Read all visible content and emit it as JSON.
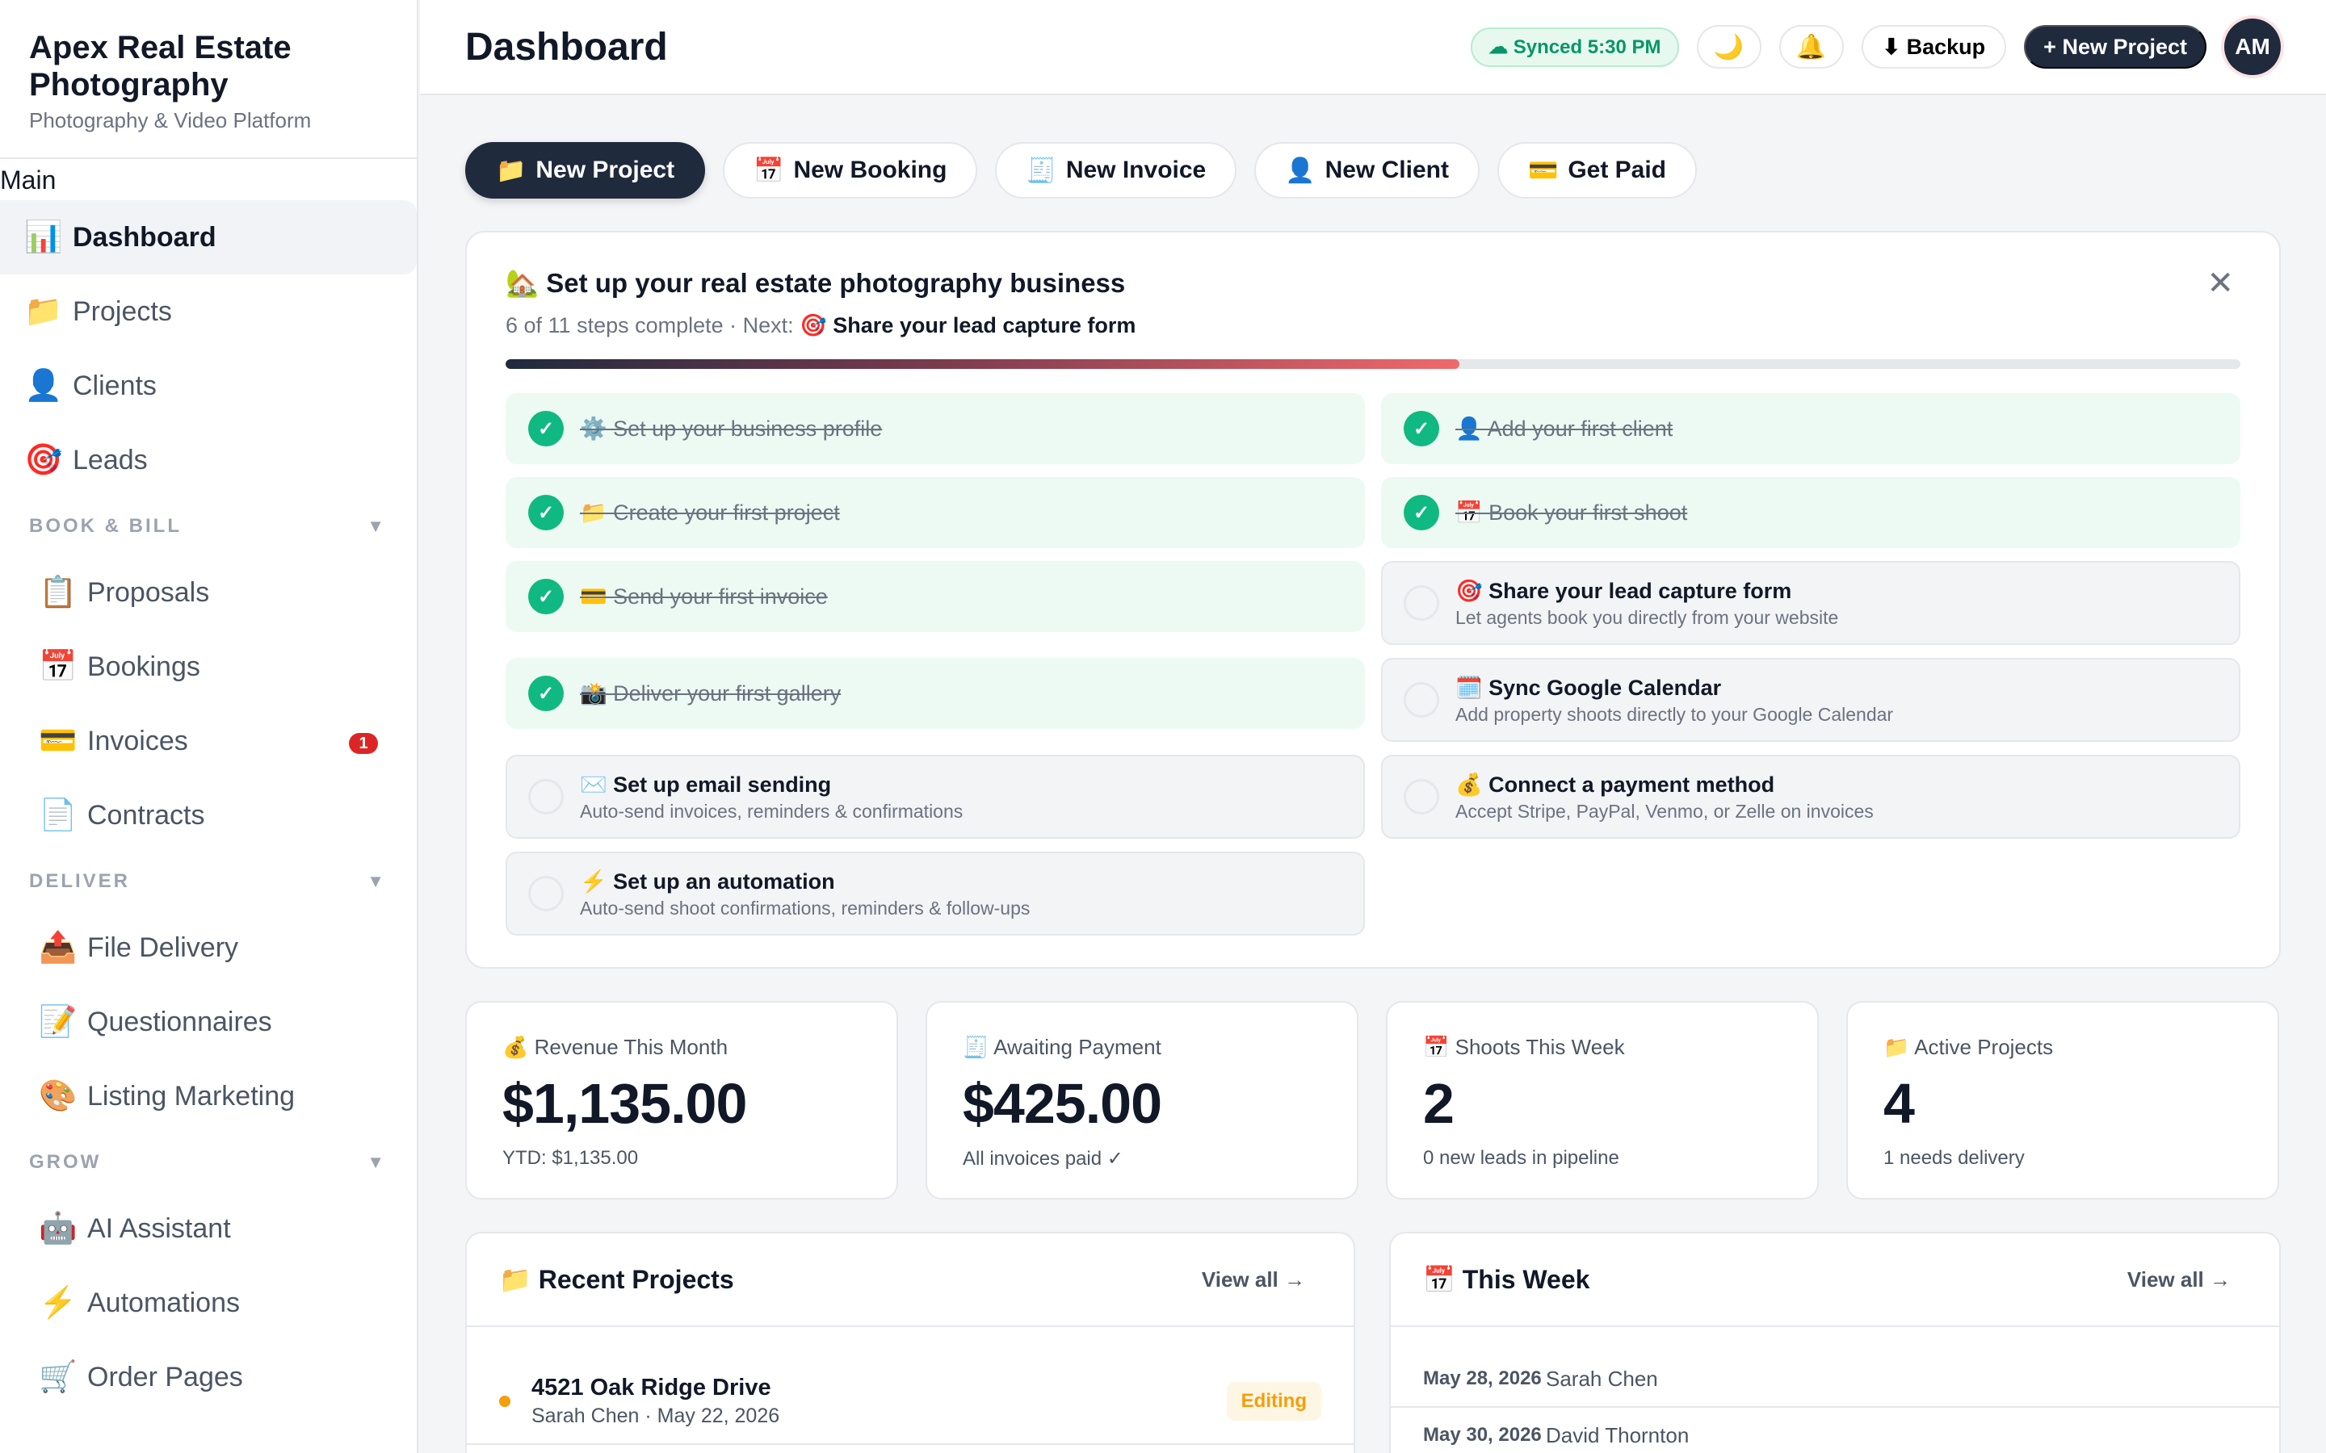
{
  "sidebar": {
    "brand_name": "Apex Real Estate Photography",
    "brand_sub": "Photography & Video Platform",
    "section_main": "Main",
    "main_items": [
      {
        "icon": "📊",
        "label": "Dashboard"
      },
      {
        "icon": "📁",
        "label": "Projects"
      },
      {
        "icon": "👤",
        "label": "Clients"
      },
      {
        "icon": "🎯",
        "label": "Leads"
      }
    ],
    "groups": [
      {
        "title": "BOOK & BILL",
        "items": [
          {
            "icon": "📋",
            "label": "Proposals"
          },
          {
            "icon": "📅",
            "label": "Bookings"
          },
          {
            "icon": "💳",
            "label": "Invoices",
            "badge": "1"
          },
          {
            "icon": "📄",
            "label": "Contracts"
          }
        ]
      },
      {
        "title": "DELIVER",
        "items": [
          {
            "icon": "📤",
            "label": "File Delivery"
          },
          {
            "icon": "📝",
            "label": "Questionnaires"
          },
          {
            "icon": "🎨",
            "label": "Listing Marketing"
          }
        ]
      },
      {
        "title": "GROW",
        "items": [
          {
            "icon": "🤖",
            "label": "AI Assistant"
          },
          {
            "icon": "⚡",
            "label": "Automations"
          },
          {
            "icon": "🛒",
            "label": "Order Pages"
          }
        ]
      }
    ]
  },
  "header": {
    "title": "Dashboard",
    "synced": "☁ Synced 5:30 PM",
    "theme_icon": "🌙",
    "bell_icon": "🔔",
    "backup": "⬇ Backup",
    "new_project": "+ New Project",
    "avatar": "AM"
  },
  "quick_actions": [
    {
      "icon": "📁",
      "label": "New Project"
    },
    {
      "icon": "📅",
      "label": "New Booking"
    },
    {
      "icon": "🧾",
      "label": "New Invoice"
    },
    {
      "icon": "👤",
      "label": "New Client"
    },
    {
      "icon": "💳",
      "label": "Get Paid"
    }
  ],
  "setup": {
    "title": "🏡 Set up your real estate photography business",
    "progress_text": "6 of 11 steps complete · Next: ",
    "next_step": "🎯 Share your lead capture form",
    "progress_fraction": 0.55,
    "close": "✕",
    "steps": [
      {
        "label": "⚙️ Set up your business profile",
        "done": true
      },
      {
        "label": "👤 Add your first client",
        "done": true
      },
      {
        "label": "📁 Create your first project",
        "done": true
      },
      {
        "label": "📅 Book your first shoot",
        "done": true
      },
      {
        "label": "💳 Send your first invoice",
        "done": true
      },
      {
        "label": "🎯 Share your lead capture form",
        "desc": "Let agents book you directly from your website",
        "done": false
      },
      {
        "label": "📸 Deliver your first gallery",
        "done": true
      },
      {
        "label": "🗓️ Sync Google Calendar",
        "desc": "Add property shoots directly to your Google Calendar",
        "done": false
      },
      {
        "label": "✉️ Set up email sending",
        "desc": "Auto-send invoices, reminders & confirmations",
        "done": false
      },
      {
        "label": "💰 Connect a payment method",
        "desc": "Accept Stripe, PayPal, Venmo, or Zelle on invoices",
        "done": false
      },
      {
        "label": "⚡ Set up an automation",
        "desc": "Auto-send shoot confirmations, reminders & follow-ups",
        "done": false
      }
    ]
  },
  "stats": [
    {
      "label": "💰 Revenue This Month",
      "value": "$1,135.00",
      "sub": "YTD: $1,135.00"
    },
    {
      "label": "🧾 Awaiting Payment",
      "value": "$425.00",
      "sub": "All invoices paid ✓"
    },
    {
      "label": "📅 Shoots This Week",
      "value": "2",
      "sub": "0 new leads in pipeline"
    },
    {
      "label": "📁 Active Projects",
      "value": "4",
      "sub": "1 needs delivery"
    }
  ],
  "recent_projects": {
    "title": "📁 Recent Projects",
    "view_all": "View all →",
    "rows": [
      {
        "title": "4521 Oak Ridge Drive",
        "sub": "Sarah Chen · May 22, 2026",
        "status": "Editing"
      }
    ]
  },
  "this_week": {
    "title": "📅 This Week",
    "view_all": "View all →",
    "rows": [
      {
        "date": "May 28, 2026",
        "name": "Sarah Chen"
      },
      {
        "date": "May 30, 2026",
        "name": "David Thornton"
      }
    ]
  }
}
